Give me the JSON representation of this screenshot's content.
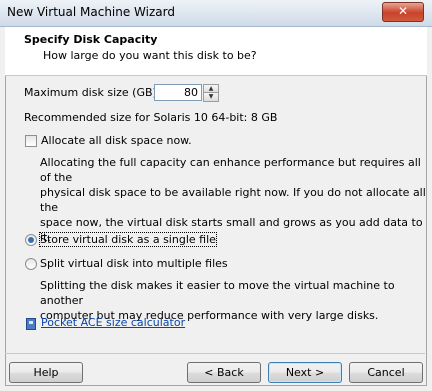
{
  "window": {
    "title": "New Virtual Machine Wizard",
    "close_glyph": "✕"
  },
  "header": {
    "title": "Specify Disk Capacity",
    "subtitle": "How large do you want this disk to be?"
  },
  "disk_size": {
    "label": "Maximum disk size (GB):",
    "value": "80",
    "up_glyph": "▲",
    "down_glyph": "▼"
  },
  "recommended": "Recommended size for Solaris 10 64-bit: 8 GB",
  "allocate": {
    "label": "Allocate all disk space now.",
    "checked": false,
    "description_lines": [
      "Allocating the full capacity can enhance performance but requires all of the",
      "physical disk space to be available right now. If you do not allocate all the",
      "space now, the virtual disk starts small and grows as you add data to it."
    ]
  },
  "store_single": {
    "label": "Store virtual disk as a single file",
    "selected": true
  },
  "split_multiple": {
    "label": "Split virtual disk into multiple files",
    "selected": false,
    "description_lines": [
      "Splitting the disk makes it easier to move the virtual machine to another",
      "computer but may reduce performance with very large disks."
    ]
  },
  "calculator_link": "Pocket ACE size calculator",
  "buttons": {
    "help": "Help",
    "back": "< Back",
    "next": "Next >",
    "cancel": "Cancel"
  },
  "icons": {
    "close": "close-icon",
    "calculator": "calculator-icon"
  }
}
